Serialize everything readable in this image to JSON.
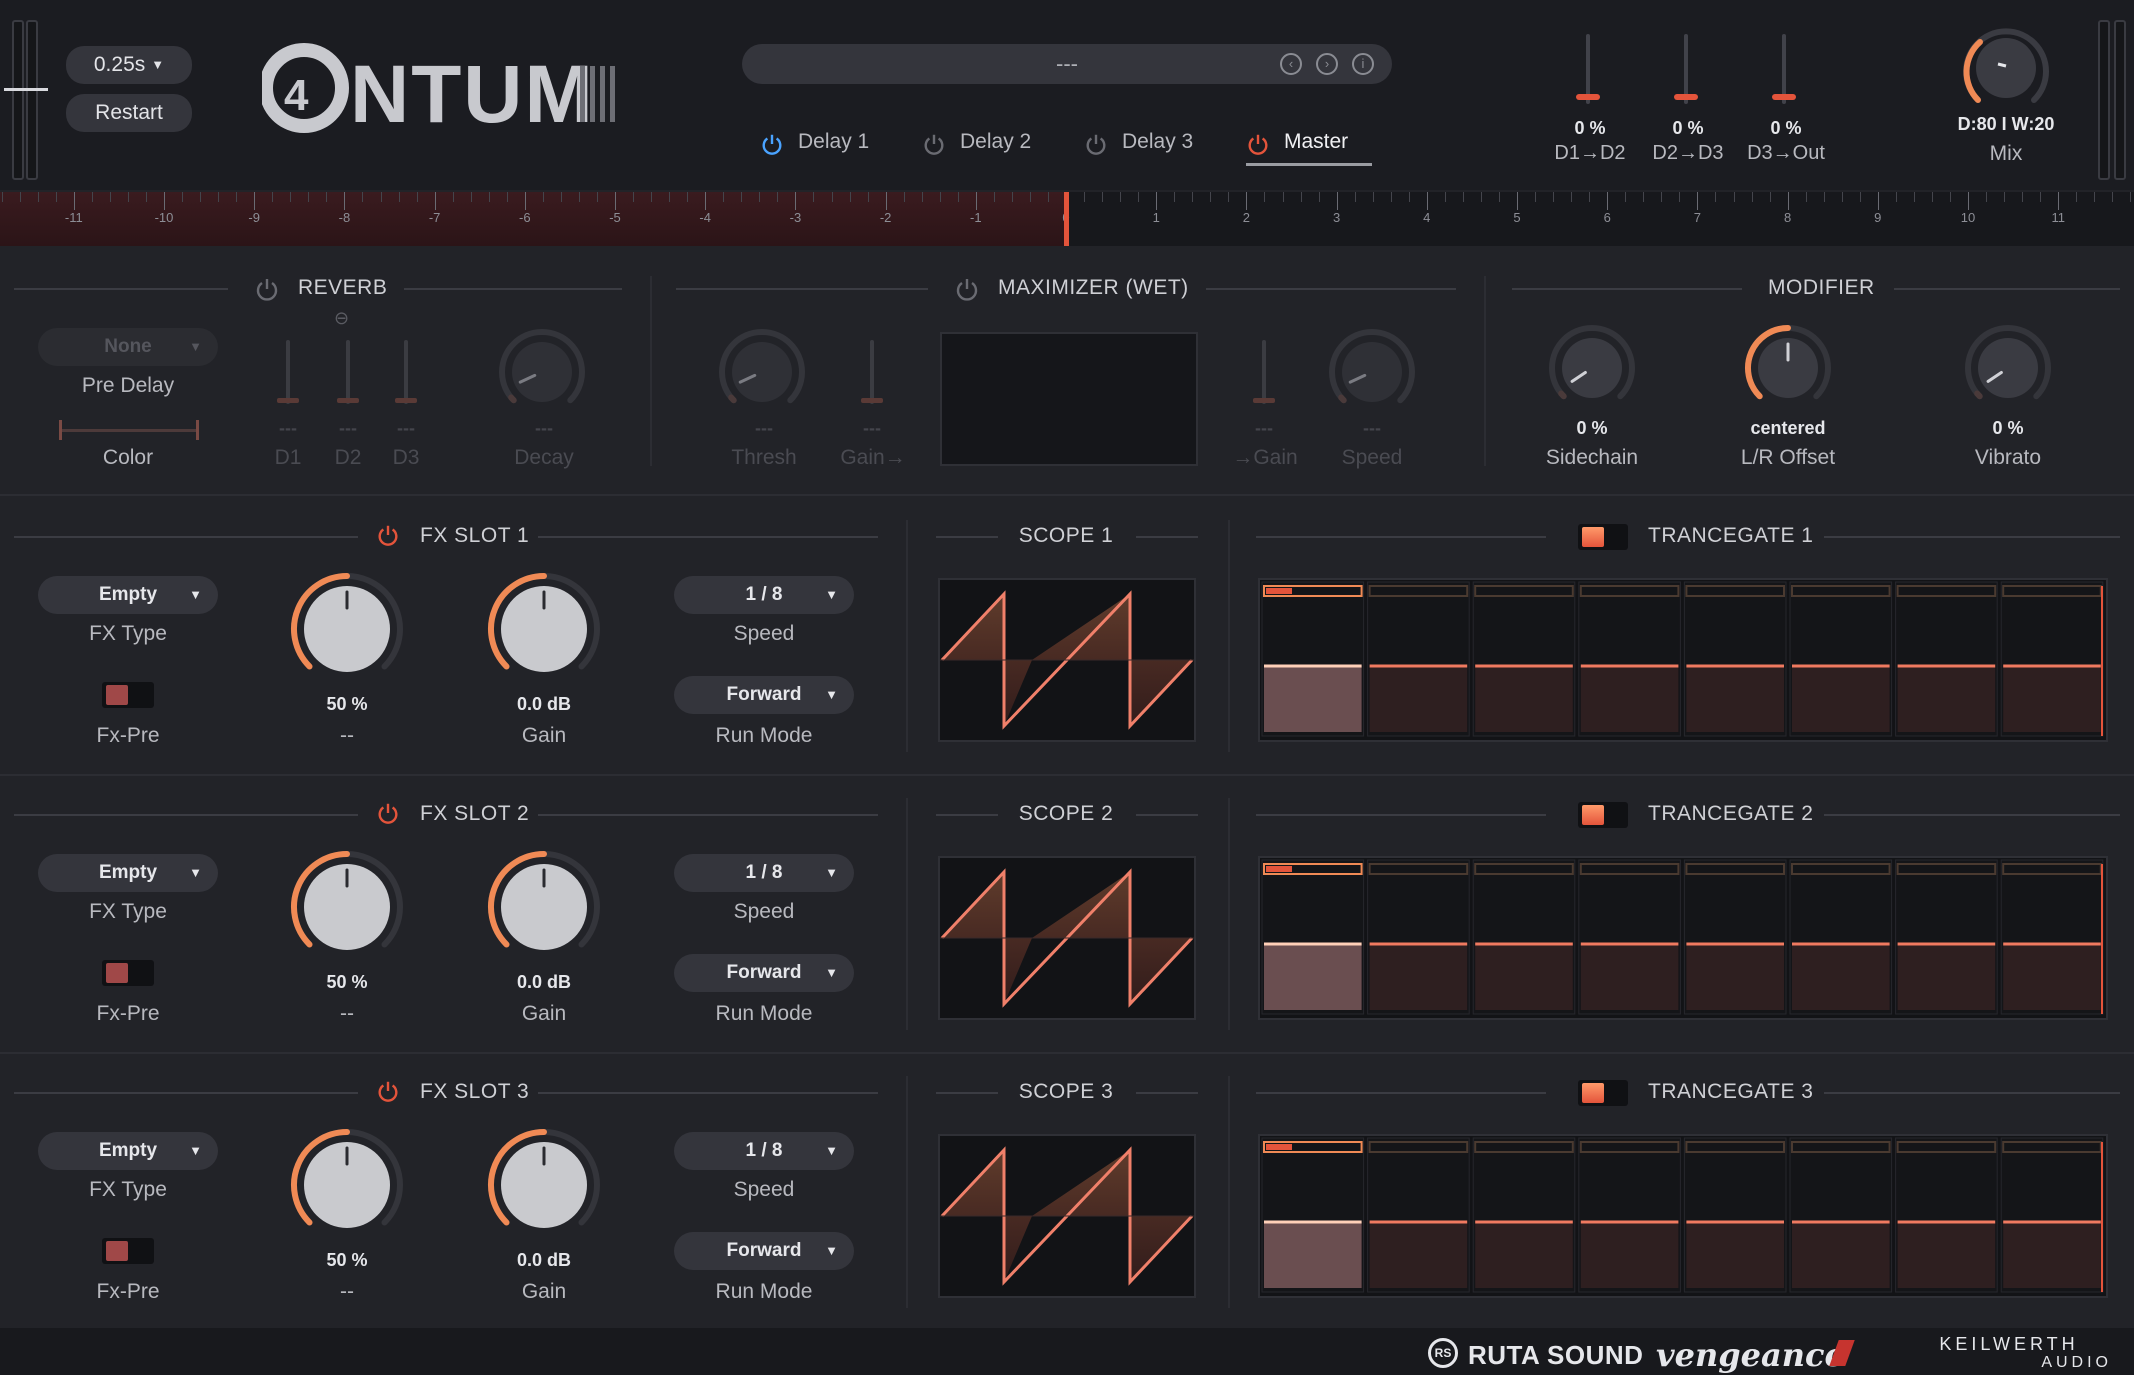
{
  "header": {
    "time_value": "0.25s",
    "restart_label": "Restart",
    "logo_text": "Q4NTUM",
    "preset_name": "---",
    "tabs": [
      {
        "label": "Delay 1",
        "active": false,
        "power_color": "#4aa3ff"
      },
      {
        "label": "Delay 2",
        "active": false,
        "power_color": "#6a6b72"
      },
      {
        "label": "Delay 3",
        "active": false,
        "power_color": "#6a6b72"
      },
      {
        "label": "Master",
        "active": true,
        "power_color": "#e4543b"
      }
    ],
    "routing": [
      {
        "value": "0 %",
        "label": "D1→D2"
      },
      {
        "value": "0 %",
        "label": "D2→D3"
      },
      {
        "value": "0 %",
        "label": "D3→Out"
      }
    ],
    "mix": {
      "value": "D:80 I W:20",
      "label": "Mix"
    }
  },
  "timeline": {
    "negative": [
      "-11",
      "-10",
      "-9",
      "-8",
      "-7",
      "-6",
      "-5",
      "-4",
      "-3",
      "-2",
      "-1"
    ],
    "positive": [
      "0",
      "1",
      "2",
      "3",
      "4",
      "5",
      "6",
      "7",
      "8",
      "9",
      "10",
      "11"
    ]
  },
  "reverb": {
    "title": "REVERB",
    "predelay_select": "None",
    "predelay_label": "Pre Delay",
    "color_label": "Color",
    "fader_values": [
      "---",
      "---",
      "---"
    ],
    "fader_labels": [
      "D1",
      "D2",
      "D3"
    ],
    "decay_value": "---",
    "decay_label": "Decay"
  },
  "maximizer": {
    "title": "MAXIMIZER (WET)",
    "thresh_value": "---",
    "thresh_label": "Thresh",
    "gain_in_value": "---",
    "gain_in_label": "Gain→",
    "gain_out_value": "---",
    "gain_out_label": "→Gain",
    "speed_value": "---",
    "speed_label": "Speed"
  },
  "modifier": {
    "title": "MODIFIER",
    "knobs": [
      {
        "value": "0 %",
        "label": "Sidechain"
      },
      {
        "value": "centered",
        "label": "L/R Offset"
      },
      {
        "value": "0 %",
        "label": "Vibrato"
      }
    ]
  },
  "slots": [
    {
      "title": "FX SLOT 1",
      "fx_type": "Empty",
      "fx_type_label": "FX Type",
      "fxpre_label": "Fx-Pre",
      "mix_value": "50 %",
      "mix_label": "--",
      "gain_value": "0.0 dB",
      "gain_label": "Gain",
      "speed": "1 / 8",
      "speed_label": "Speed",
      "runmode": "Forward",
      "runmode_label": "Run Mode",
      "scope_title": "SCOPE 1",
      "gate_title": "TRANCEGATE 1"
    },
    {
      "title": "FX SLOT 2",
      "fx_type": "Empty",
      "fx_type_label": "FX Type",
      "fxpre_label": "Fx-Pre",
      "mix_value": "50 %",
      "mix_label": "--",
      "gain_value": "0.0 dB",
      "gain_label": "Gain",
      "speed": "1 / 8",
      "speed_label": "Speed",
      "runmode": "Forward",
      "runmode_label": "Run Mode",
      "scope_title": "SCOPE 2",
      "gate_title": "TRANCEGATE 2"
    },
    {
      "title": "FX SLOT 3",
      "fx_type": "Empty",
      "fx_type_label": "FX Type",
      "fxpre_label": "Fx-Pre",
      "mix_value": "50 %",
      "mix_label": "--",
      "gain_value": "0.0 dB",
      "gain_label": "Gain",
      "speed": "1 / 8",
      "speed_label": "Speed",
      "runmode": "Forward",
      "runmode_label": "Run Mode",
      "scope_title": "SCOPE 3",
      "gate_title": "TRANCEGATE 3"
    }
  ],
  "footer": {
    "brand1": "RUTA SOUND",
    "brand2": "vengeance",
    "brand3_line1": "KEILWERTH",
    "brand3_line2": "AUDIO"
  },
  "colors": {
    "accent": "#e4543b",
    "knob_arc": "#f08a55",
    "active_tab": "#4aa3ff"
  }
}
